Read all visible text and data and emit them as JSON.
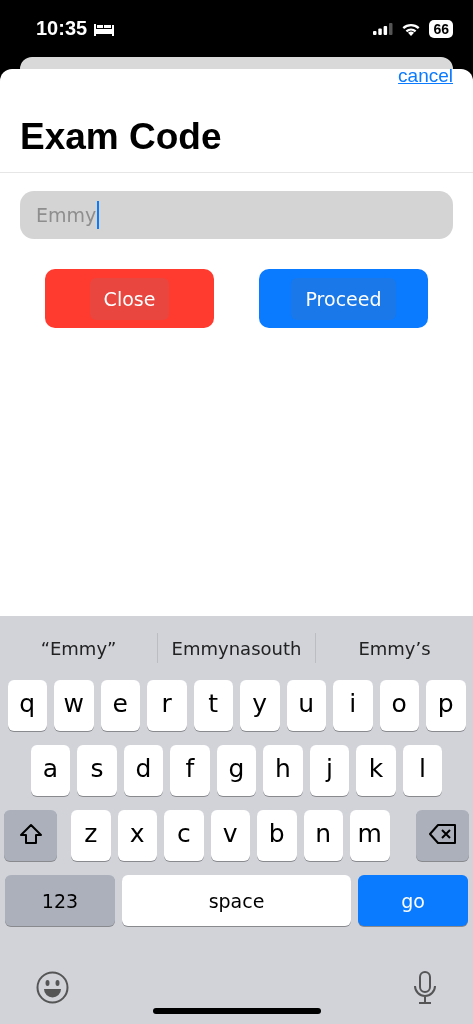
{
  "status_bar": {
    "time": "10:35",
    "battery": "66"
  },
  "sheet": {
    "cancel": "cancel",
    "title": "Exam Code",
    "field": {
      "value": "Emmy",
      "focused": true
    },
    "buttons": [
      {
        "label": "Close",
        "kind": "danger"
      },
      {
        "label": "Proceed",
        "kind": "primary"
      }
    ]
  },
  "keyboard": {
    "suggestions": [
      "“Emmy”",
      "Emmynasouth",
      "Emmy’s"
    ],
    "rows": [
      [
        {
          "kind": "letter",
          "label": "q"
        },
        {
          "kind": "letter",
          "label": "w"
        },
        {
          "kind": "letter",
          "label": "e"
        },
        {
          "kind": "letter",
          "label": "r"
        },
        {
          "kind": "letter",
          "label": "t"
        },
        {
          "kind": "letter",
          "label": "y"
        },
        {
          "kind": "letter",
          "label": "u"
        },
        {
          "kind": "letter",
          "label": "i"
        },
        {
          "kind": "letter",
          "label": "o"
        },
        {
          "kind": "letter",
          "label": "p"
        }
      ],
      [
        {
          "kind": "letter",
          "label": "a"
        },
        {
          "kind": "letter",
          "label": "s"
        },
        {
          "kind": "letter",
          "label": "d"
        },
        {
          "kind": "letter",
          "label": "f"
        },
        {
          "kind": "letter",
          "label": "g"
        },
        {
          "kind": "letter",
          "label": "h"
        },
        {
          "kind": "letter",
          "label": "j"
        },
        {
          "kind": "letter",
          "label": "k"
        },
        {
          "kind": "letter",
          "label": "l"
        }
      ],
      [
        {
          "kind": "shift"
        },
        {
          "kind": "letter",
          "label": "z"
        },
        {
          "kind": "letter",
          "label": "x"
        },
        {
          "kind": "letter",
          "label": "c"
        },
        {
          "kind": "letter",
          "label": "v"
        },
        {
          "kind": "letter",
          "label": "b"
        },
        {
          "kind": "letter",
          "label": "n"
        },
        {
          "kind": "letter",
          "label": "m"
        },
        {
          "kind": "delete"
        }
      ]
    ],
    "bottom_keys": [
      {
        "kind": "mode",
        "label": "123"
      },
      {
        "kind": "space",
        "label": "space"
      },
      {
        "kind": "go",
        "label": "go"
      }
    ]
  }
}
